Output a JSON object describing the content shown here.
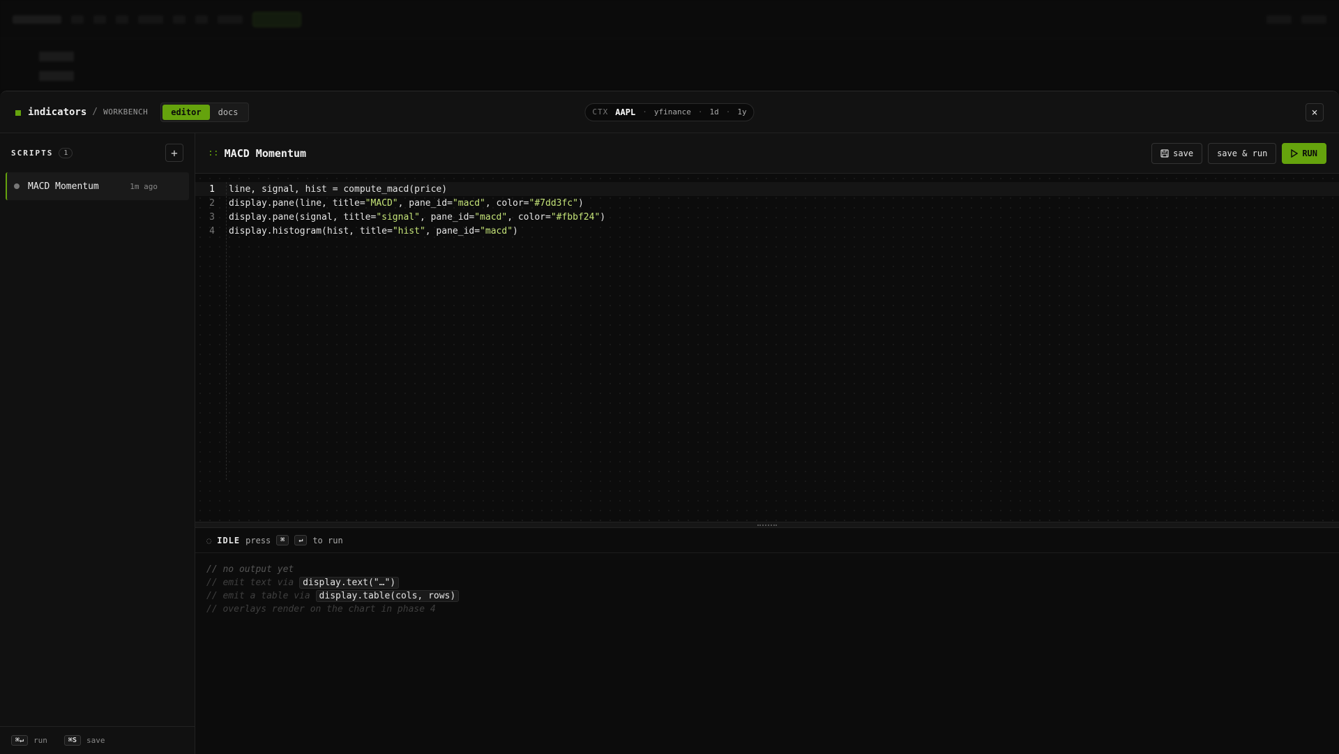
{
  "modal": {
    "brand": "indicators",
    "separator": "/",
    "subtitle": "WORKBENCH",
    "tabs": [
      {
        "label": "editor",
        "active": true
      },
      {
        "label": "docs",
        "active": false
      }
    ],
    "context": {
      "label": "CTX",
      "symbol": "AAPL",
      "source": "yfinance",
      "interval": "1d",
      "range": "1y",
      "dot": "·"
    },
    "close_label": "×"
  },
  "sidebar": {
    "title": "SCRIPTS",
    "count": "1",
    "add_label": "+",
    "items": [
      {
        "name": "MACD Momentum",
        "time": "1m ago"
      }
    ],
    "footer": {
      "run_key": "⌘↵",
      "run_label": "run",
      "save_key": "⌘S",
      "save_label": "save"
    }
  },
  "editor": {
    "dots": "::",
    "title": "MACD Momentum",
    "save_label": "save",
    "save_run_label": "save & run",
    "run_label": "RUN",
    "lines": [
      {
        "num": "1",
        "text": "line, signal, hist = compute_macd(price)"
      },
      {
        "num": "2",
        "text": "display.pane(line, title=\"MACD\", pane_id=\"macd\", color=\"#7dd3fc\")"
      },
      {
        "num": "3",
        "text": "display.pane(signal, title=\"signal\", pane_id=\"macd\", color=\"#fbbf24\")"
      },
      {
        "num": "4",
        "text": "display.histogram(hist, title=\"hist\", pane_id=\"macd\")"
      }
    ]
  },
  "console": {
    "status": "IDLE",
    "press": "press",
    "key1": "⌘",
    "key2": "↵",
    "to_run": "to run",
    "line1": "// no output yet",
    "line2_prefix": "// emit text via",
    "line2_code": "display.text(\"…\")",
    "line3_prefix": "// emit a table via",
    "line3_code": "display.table(cols, rows)",
    "line4": "// overlays render on the chart in phase 4"
  },
  "colors": {
    "accent": "#65a30d",
    "background": "#0e0e0e",
    "string": "#c5e478"
  }
}
